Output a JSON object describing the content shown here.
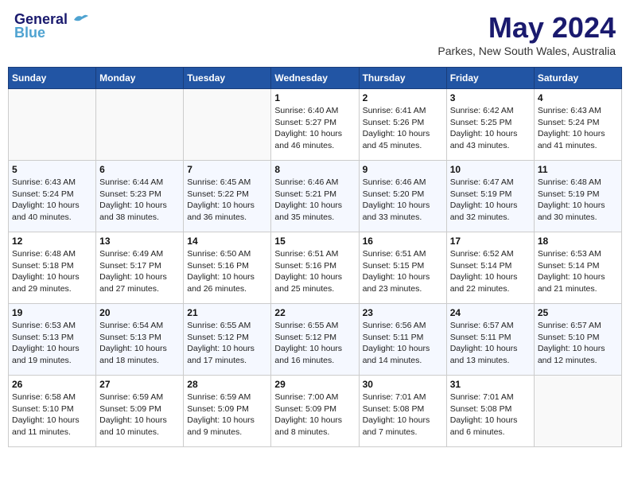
{
  "header": {
    "logo_line1": "General",
    "logo_line2": "Blue",
    "month": "May 2024",
    "location": "Parkes, New South Wales, Australia"
  },
  "days_of_week": [
    "Sunday",
    "Monday",
    "Tuesday",
    "Wednesday",
    "Thursday",
    "Friday",
    "Saturday"
  ],
  "weeks": [
    [
      {
        "day": "",
        "info": ""
      },
      {
        "day": "",
        "info": ""
      },
      {
        "day": "",
        "info": ""
      },
      {
        "day": "1",
        "info": "Sunrise: 6:40 AM\nSunset: 5:27 PM\nDaylight: 10 hours\nand 46 minutes."
      },
      {
        "day": "2",
        "info": "Sunrise: 6:41 AM\nSunset: 5:26 PM\nDaylight: 10 hours\nand 45 minutes."
      },
      {
        "day": "3",
        "info": "Sunrise: 6:42 AM\nSunset: 5:25 PM\nDaylight: 10 hours\nand 43 minutes."
      },
      {
        "day": "4",
        "info": "Sunrise: 6:43 AM\nSunset: 5:24 PM\nDaylight: 10 hours\nand 41 minutes."
      }
    ],
    [
      {
        "day": "5",
        "info": "Sunrise: 6:43 AM\nSunset: 5:24 PM\nDaylight: 10 hours\nand 40 minutes."
      },
      {
        "day": "6",
        "info": "Sunrise: 6:44 AM\nSunset: 5:23 PM\nDaylight: 10 hours\nand 38 minutes."
      },
      {
        "day": "7",
        "info": "Sunrise: 6:45 AM\nSunset: 5:22 PM\nDaylight: 10 hours\nand 36 minutes."
      },
      {
        "day": "8",
        "info": "Sunrise: 6:46 AM\nSunset: 5:21 PM\nDaylight: 10 hours\nand 35 minutes."
      },
      {
        "day": "9",
        "info": "Sunrise: 6:46 AM\nSunset: 5:20 PM\nDaylight: 10 hours\nand 33 minutes."
      },
      {
        "day": "10",
        "info": "Sunrise: 6:47 AM\nSunset: 5:19 PM\nDaylight: 10 hours\nand 32 minutes."
      },
      {
        "day": "11",
        "info": "Sunrise: 6:48 AM\nSunset: 5:19 PM\nDaylight: 10 hours\nand 30 minutes."
      }
    ],
    [
      {
        "day": "12",
        "info": "Sunrise: 6:48 AM\nSunset: 5:18 PM\nDaylight: 10 hours\nand 29 minutes."
      },
      {
        "day": "13",
        "info": "Sunrise: 6:49 AM\nSunset: 5:17 PM\nDaylight: 10 hours\nand 27 minutes."
      },
      {
        "day": "14",
        "info": "Sunrise: 6:50 AM\nSunset: 5:16 PM\nDaylight: 10 hours\nand 26 minutes."
      },
      {
        "day": "15",
        "info": "Sunrise: 6:51 AM\nSunset: 5:16 PM\nDaylight: 10 hours\nand 25 minutes."
      },
      {
        "day": "16",
        "info": "Sunrise: 6:51 AM\nSunset: 5:15 PM\nDaylight: 10 hours\nand 23 minutes."
      },
      {
        "day": "17",
        "info": "Sunrise: 6:52 AM\nSunset: 5:14 PM\nDaylight: 10 hours\nand 22 minutes."
      },
      {
        "day": "18",
        "info": "Sunrise: 6:53 AM\nSunset: 5:14 PM\nDaylight: 10 hours\nand 21 minutes."
      }
    ],
    [
      {
        "day": "19",
        "info": "Sunrise: 6:53 AM\nSunset: 5:13 PM\nDaylight: 10 hours\nand 19 minutes."
      },
      {
        "day": "20",
        "info": "Sunrise: 6:54 AM\nSunset: 5:13 PM\nDaylight: 10 hours\nand 18 minutes."
      },
      {
        "day": "21",
        "info": "Sunrise: 6:55 AM\nSunset: 5:12 PM\nDaylight: 10 hours\nand 17 minutes."
      },
      {
        "day": "22",
        "info": "Sunrise: 6:55 AM\nSunset: 5:12 PM\nDaylight: 10 hours\nand 16 minutes."
      },
      {
        "day": "23",
        "info": "Sunrise: 6:56 AM\nSunset: 5:11 PM\nDaylight: 10 hours\nand 14 minutes."
      },
      {
        "day": "24",
        "info": "Sunrise: 6:57 AM\nSunset: 5:11 PM\nDaylight: 10 hours\nand 13 minutes."
      },
      {
        "day": "25",
        "info": "Sunrise: 6:57 AM\nSunset: 5:10 PM\nDaylight: 10 hours\nand 12 minutes."
      }
    ],
    [
      {
        "day": "26",
        "info": "Sunrise: 6:58 AM\nSunset: 5:10 PM\nDaylight: 10 hours\nand 11 minutes."
      },
      {
        "day": "27",
        "info": "Sunrise: 6:59 AM\nSunset: 5:09 PM\nDaylight: 10 hours\nand 10 minutes."
      },
      {
        "day": "28",
        "info": "Sunrise: 6:59 AM\nSunset: 5:09 PM\nDaylight: 10 hours\nand 9 minutes."
      },
      {
        "day": "29",
        "info": "Sunrise: 7:00 AM\nSunset: 5:09 PM\nDaylight: 10 hours\nand 8 minutes."
      },
      {
        "day": "30",
        "info": "Sunrise: 7:01 AM\nSunset: 5:08 PM\nDaylight: 10 hours\nand 7 minutes."
      },
      {
        "day": "31",
        "info": "Sunrise: 7:01 AM\nSunset: 5:08 PM\nDaylight: 10 hours\nand 6 minutes."
      },
      {
        "day": "",
        "info": ""
      }
    ]
  ]
}
